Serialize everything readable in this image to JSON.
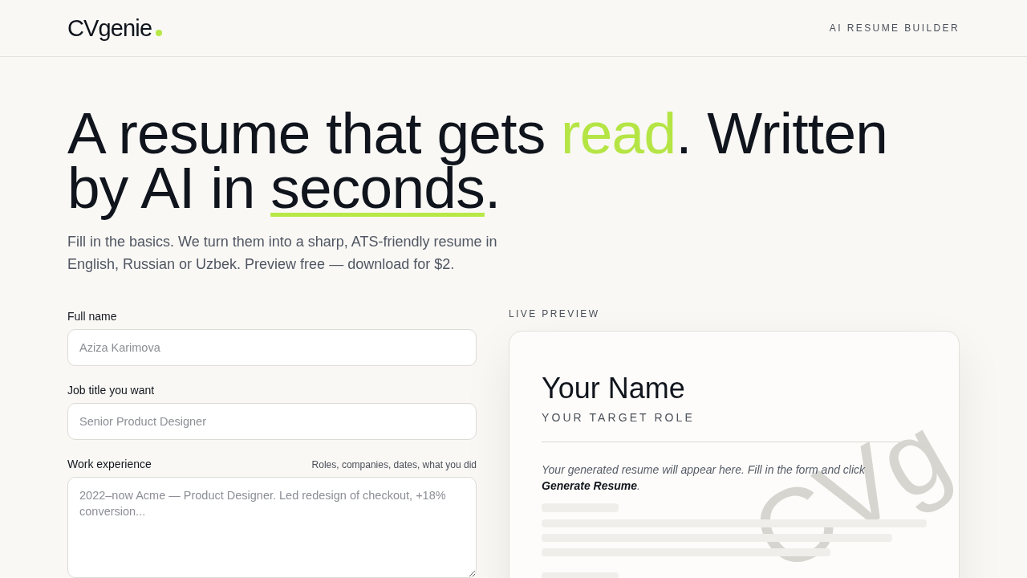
{
  "header": {
    "logo": "CVgenie",
    "tagline": "AI RESUME BUILDER"
  },
  "hero": {
    "headline": [
      {
        "kind": "plain",
        "text": "A resume that gets "
      },
      {
        "kind": "accent",
        "text": "read"
      },
      {
        "kind": "plain",
        "text": ". Written by AI in "
      },
      {
        "kind": "underline",
        "text": "seconds"
      },
      {
        "kind": "plain",
        "text": "."
      }
    ],
    "subtitle": "Fill in the basics. We turn them into a sharp, ATS-friendly resume in English, Russian or Uzbek. Preview free — download for $2."
  },
  "form": {
    "fields": [
      {
        "kind": "input",
        "label": "Full name",
        "placeholder": "Aziza Karimova"
      },
      {
        "kind": "input",
        "label": "Job title you want",
        "placeholder": "Senior Product Designer"
      },
      {
        "kind": "textarea",
        "label": "Work experience",
        "hint": "Roles, companies, dates, what you did",
        "placeholder": "2022–now Acme — Product Designer. Led redesign of checkout, +18% conversion..."
      }
    ]
  },
  "preview": {
    "label": "LIVE PREVIEW",
    "name": "Your Name",
    "role": "YOUR TARGET ROLE",
    "message": "Your generated resume will appear here. Fill in the form and click **Generate Resume**.",
    "watermark": "CVg"
  }
}
